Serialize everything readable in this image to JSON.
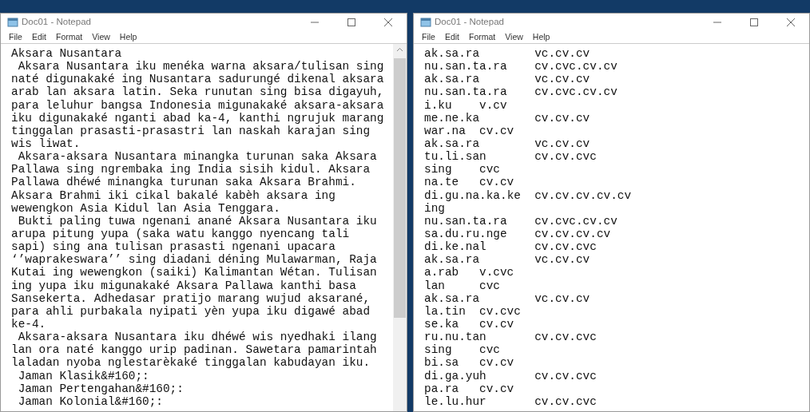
{
  "windows": [
    {
      "title": "Doc01 - Notepad",
      "menu": [
        "File",
        "Edit",
        "Format",
        "View",
        "Help"
      ],
      "kind": "prose",
      "lines": [
        "Aksara Nusantara",
        " Aksara Nusantara iku menéka warna aksara/tulisan sing",
        "naté digunakaké ing Nusantara sadurungé dikenal aksara",
        "arab lan aksara latin. Seka runutan sing bisa digayuh,",
        "para leluhur bangsa Indonesia migunakaké aksara-aksara",
        "iku digunakaké nganti abad ka-4, kanthi ngrujuk marang",
        "tinggalan prasasti-prasastri lan naskah karajan sing",
        "wis liwat.",
        " Aksara-aksara Nusantara minangka turunan saka Aksara",
        "Pallawa sing ngrembaka ing India sisih kidul. Aksara",
        "Pallawa dhéwé minangka turunan saka Aksara Brahmi.",
        "Aksara Brahmi iki cikal bakalé kabèh aksara ing",
        "wewengkon Asia Kidul lan Asia Tenggara.",
        " Bukti paling tuwa ngenani anané Aksara Nusantara iku",
        "arupa pitung yupa (saka watu kanggo nyencang tali",
        "sapi) sing ana tulisan prasasti ngenani upacara",
        "‘’waprakeswara’’ sing diadani déning Mulawarman, Raja",
        "Kutai ing wewengkon (saiki) Kalimantan Wétan. Tulisan",
        "ing yupa iku migunakaké Aksara Pallawa kanthi basa",
        "Sansekerta. Adhedasar pratijo marang wujud aksarané,",
        "para ahli purbakala nyipati yèn yupa iku digawé abad",
        "ke-4.",
        " Aksara-aksara Nusantara iku dhéwé wis nyedhaki ilang",
        "lan ora naté kanggo urip padinan. Sawetara pamarintah",
        "laladan nyoba nglestarèkaké tinggalan kabudayan iku.",
        " Jaman Klasik&#160;:",
        " Jaman Pertengahan&#160;:",
        " Jaman Kolonial&#160;:"
      ]
    },
    {
      "title": "Doc01 - Notepad",
      "menu": [
        "File",
        "Edit",
        "Format",
        "View",
        "Help"
      ],
      "kind": "table",
      "rows": [
        {
          "syllables": "ak.sa.ra",
          "pattern": "vc.cv.cv"
        },
        {
          "syllables": "nu.san.ta.ra",
          "pattern": "cv.cvc.cv.cv"
        },
        {
          "syllables": "ak.sa.ra",
          "pattern": "vc.cv.cv"
        },
        {
          "syllables": "nu.san.ta.ra",
          "pattern": "cv.cvc.cv.cv"
        },
        {
          "syllables": "i.ku",
          "pattern": "v.cv"
        },
        {
          "syllables": "me.ne.ka",
          "pattern": "cv.cv.cv"
        },
        {
          "syllables": "war.na",
          "pattern": "cv.cv"
        },
        {
          "syllables": "ak.sa.ra",
          "pattern": "vc.cv.cv"
        },
        {
          "syllables": "tu.li.san",
          "pattern": "cv.cv.cvc"
        },
        {
          "syllables": "sing",
          "pattern": "cvc"
        },
        {
          "syllables": "na.te",
          "pattern": "cv.cv"
        },
        {
          "syllables": "di.gu.na.ka.ke",
          "pattern": "cv.cv.cv.cv.cv"
        },
        {
          "syllables": "ing"
        },
        {
          "syllables": "nu.san.ta.ra",
          "pattern": "cv.cvc.cv.cv"
        },
        {
          "syllables": "sa.du.ru.nge",
          "pattern": "cv.cv.cv.cv"
        },
        {
          "syllables": "di.ke.nal",
          "pattern": "cv.cv.cvc"
        },
        {
          "syllables": "ak.sa.ra",
          "pattern": "vc.cv.cv"
        },
        {
          "syllables": "a.rab",
          "pattern": "v.cvc"
        },
        {
          "syllables": "lan",
          "pattern": "cvc"
        },
        {
          "syllables": "ak.sa.ra",
          "pattern": "vc.cv.cv"
        },
        {
          "syllables": "la.tin",
          "pattern": "cv.cvc"
        },
        {
          "syllables": "se.ka",
          "pattern": "cv.cv"
        },
        {
          "syllables": "ru.nu.tan",
          "pattern": "cv.cv.cvc"
        },
        {
          "syllables": "sing",
          "pattern": "cvc"
        },
        {
          "syllables": "bi.sa",
          "pattern": "cv.cv"
        },
        {
          "syllables": "di.ga.yuh",
          "pattern": "cv.cv.cvc"
        },
        {
          "syllables": "pa.ra",
          "pattern": "cv.cv"
        },
        {
          "syllables": "le.lu.hur",
          "pattern": "cv.cv.cvc"
        }
      ]
    }
  ]
}
